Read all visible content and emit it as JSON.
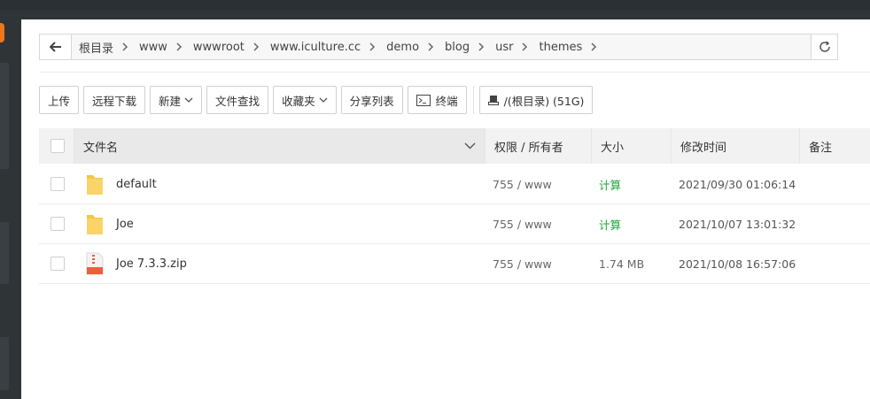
{
  "breadcrumb": {
    "items": [
      "根目录",
      "www",
      "wwwroot",
      "www.iculture.cc",
      "demo",
      "blog",
      "usr",
      "themes"
    ]
  },
  "toolbar": {
    "upload": "上传",
    "remote_download": "远程下载",
    "new": "新建",
    "file_search": "文件查找",
    "favorites": "收藏夹",
    "share_list": "分享列表",
    "terminal": "终端",
    "disk": "/(根目录) (51G)"
  },
  "table": {
    "headers": {
      "name": "文件名",
      "perm": "权限 / 所有者",
      "size": "大小",
      "time": "修改时间",
      "note": "备注"
    },
    "rows": [
      {
        "type": "folder",
        "name": "default",
        "perm": "755 / www",
        "size": "计算",
        "time": "2021/09/30 01:06:14",
        "note": ""
      },
      {
        "type": "folder",
        "name": "Joe",
        "perm": "755 / www",
        "size": "计算",
        "time": "2021/10/07 13:01:32",
        "note": ""
      },
      {
        "type": "zip",
        "name": "Joe 7.3.3.zip",
        "perm": "755 / www",
        "size": "1.74 MB",
        "time": "2021/10/08 16:57:06",
        "note": ""
      }
    ]
  },
  "colors": {
    "accent_green": "#20a53a",
    "folder_yellow": "#f6c443",
    "zip_orange": "#e8613c"
  }
}
